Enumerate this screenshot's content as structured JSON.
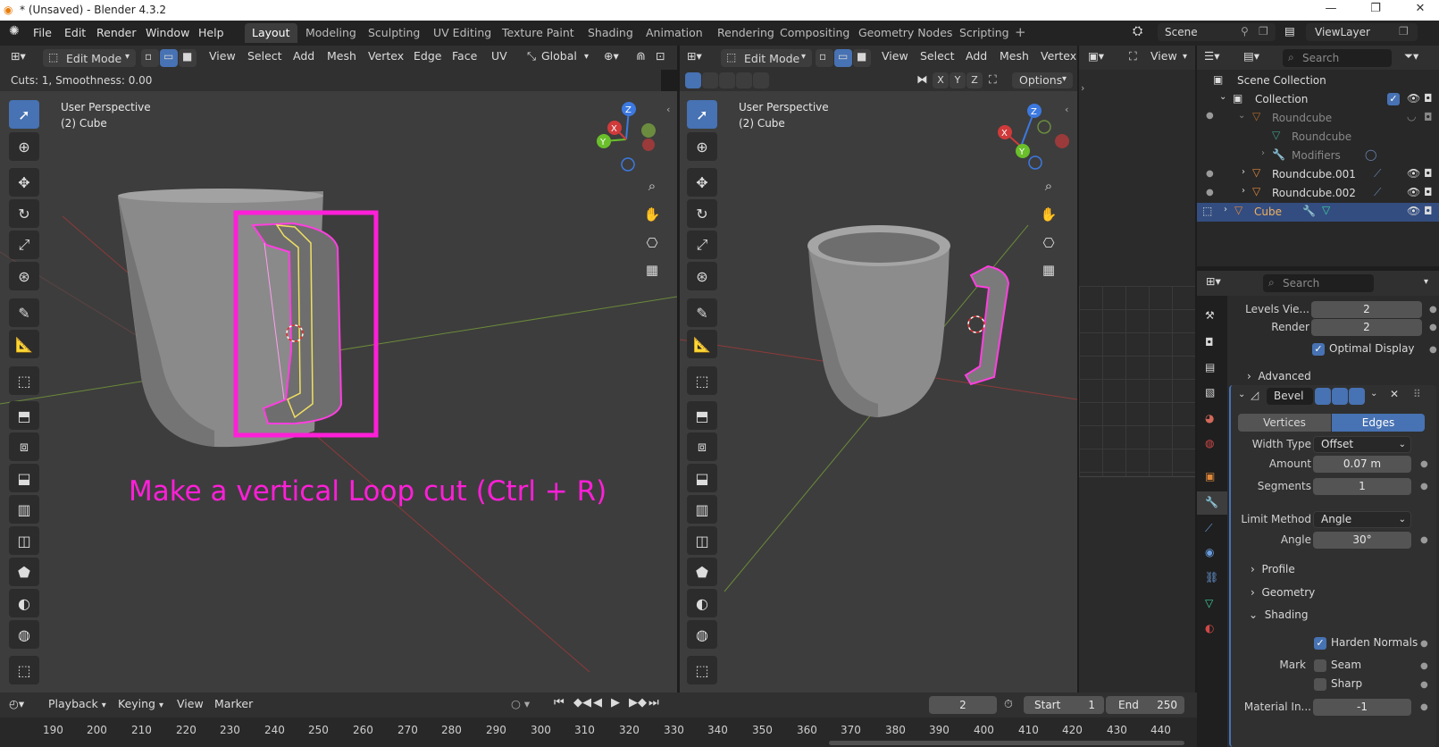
{
  "window": {
    "title": "* (Unsaved) - Blender 4.3.2"
  },
  "menu": [
    "File",
    "Edit",
    "Render",
    "Window",
    "Help"
  ],
  "workspaces": [
    "Layout",
    "Modeling",
    "Sculpting",
    "UV Editing",
    "Texture Paint",
    "Shading",
    "Animation",
    "Rendering",
    "Compositing",
    "Geometry Nodes",
    "Scripting"
  ],
  "active_workspace": "Layout",
  "scene": {
    "name": "Scene",
    "view_layer": "ViewLayer"
  },
  "viewport_left": {
    "mode": "Edit Mode",
    "menus": [
      "View",
      "Select",
      "Add",
      "Mesh",
      "Vertex",
      "Edge",
      "Face",
      "UV"
    ],
    "transform_orientation": "Global",
    "operator_status": "Cuts: 1, Smoothness: 0.00",
    "info_line1": "User Perspective",
    "info_line2": "(2) Cube",
    "callout": "Make a vertical Loop cut (Ctrl + R)"
  },
  "viewport_right": {
    "mode": "Edit Mode",
    "menus": [
      "View",
      "Select",
      "Add",
      "Mesh",
      "Vertex"
    ],
    "options_label": "Options",
    "axes": [
      "X",
      "Y",
      "Z"
    ],
    "info_line1": "User Perspective",
    "info_line2": "(2) Cube"
  },
  "small_viewport": {
    "view_label": "View"
  },
  "gizmo_labels": {
    "x": "X",
    "y": "Y",
    "z": "Z"
  },
  "outliner": {
    "search_placeholder": "Search",
    "rows": [
      {
        "label": "Scene Collection"
      },
      {
        "label": "Collection"
      },
      {
        "label": "Roundcube"
      },
      {
        "label": "Roundcube"
      },
      {
        "label": "Modifiers"
      },
      {
        "label": "Roundcube.001"
      },
      {
        "label": "Roundcube.002"
      },
      {
        "label": "Cube"
      }
    ]
  },
  "properties": {
    "search_placeholder": "Search",
    "levels_viewport_label": "Levels Vie...",
    "levels_viewport_value": "2",
    "render_label": "Render",
    "render_value": "2",
    "optimal_display": "Optimal Display",
    "advanced": "Advanced",
    "modifier_name": "Bevel",
    "vertices_tab": "Vertices",
    "edges_tab": "Edges",
    "width_type_label": "Width Type",
    "width_type_value": "Offset",
    "amount_label": "Amount",
    "amount_value": "0.07 m",
    "segments_label": "Segments",
    "segments_value": "1",
    "limit_method_label": "Limit Method",
    "limit_method_value": "Angle",
    "angle_label": "Angle",
    "angle_value": "30°",
    "profile": "Profile",
    "geometry": "Geometry",
    "shading": "Shading",
    "harden_normals": "Harden Normals",
    "mark_label": "Mark",
    "seam": "Seam",
    "sharp": "Sharp",
    "material_label": "Material In...",
    "material_value": "-1"
  },
  "timeline": {
    "menus": [
      "Playback",
      "Keying",
      "View",
      "Marker"
    ],
    "current_frame": "2",
    "start_label": "Start",
    "start_value": "1",
    "end_label": "End",
    "end_value": "250",
    "ticks": [
      "190",
      "200",
      "210",
      "220",
      "230",
      "240",
      "250",
      "260",
      "270",
      "280",
      "290",
      "300",
      "310",
      "320",
      "330",
      "340",
      "350",
      "360",
      "370",
      "380",
      "390",
      "400",
      "410",
      "420",
      "430",
      "440"
    ]
  },
  "colors": {
    "accent": "#4772b3",
    "callout": "#ff1fd8",
    "selection": "#ff3fe0",
    "active_loop": "#f0e060"
  }
}
